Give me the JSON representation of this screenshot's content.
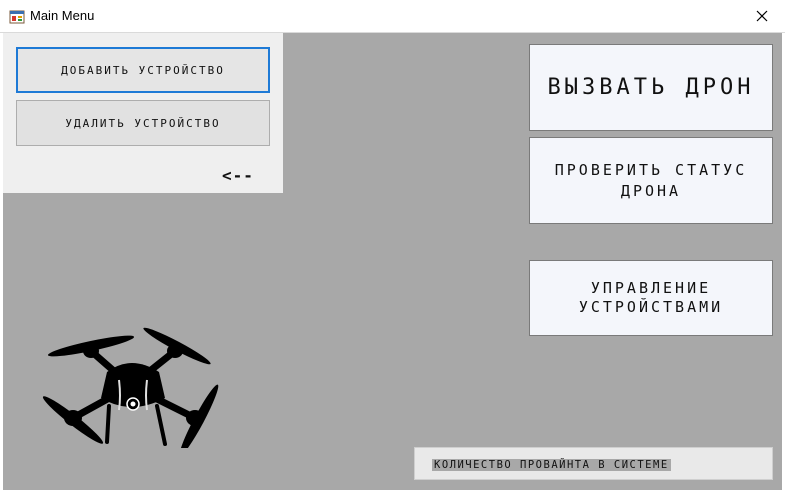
{
  "window": {
    "title": "Main Menu",
    "icon": "app-icon",
    "close_icon": "close-icon"
  },
  "left_panel": {
    "add_device_label": "Добавить устройство",
    "remove_device_label": "Удалить устройство",
    "back_label": "<--"
  },
  "actions": {
    "call_drone_label": "Вызвать дрон",
    "check_status_label": "Проверить статус дрона",
    "manage_devices_label": "Управление устройствами"
  },
  "footer": {
    "device_count_label": "Количество провайнта в системе"
  },
  "images": {
    "drone": "quadcopter-drone-image"
  },
  "colors": {
    "client_background": "#a8a8a8",
    "panel_background": "#efefef",
    "focus_border": "#1e7ad6",
    "button_background": "#f4f6fb"
  }
}
